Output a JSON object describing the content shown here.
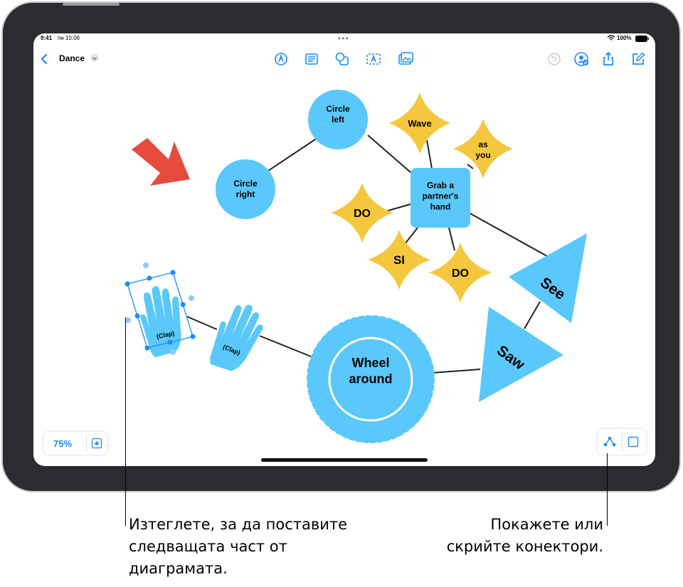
{
  "status_bar": {
    "time": "9:41",
    "date": "пн 10.06",
    "battery": "100%"
  },
  "toolbar": {
    "back_icon": "chevron-left-icon",
    "title": "Dance",
    "title_menu_icon": "chevron-down-icon",
    "center_tools": [
      "pen-icon",
      "text-box-icon",
      "shapes-icon",
      "text-icon",
      "media-icon"
    ],
    "right_tools": [
      "undo-icon",
      "collaborate-icon",
      "share-icon",
      "new-board-icon"
    ],
    "accent": "#1a8cff"
  },
  "board": {
    "nodes": {
      "circle_left": "Circle left",
      "circle_right": "Circle right",
      "wave": "Wave",
      "as_you": "as you",
      "grab": "Grab a partner's hand",
      "do1": "DO",
      "si": "SI",
      "do2": "DO",
      "see": "See",
      "saw": "Saw",
      "wheel": "Wheel around",
      "clap1": "(Clap)",
      "clap2": "(Clap)"
    },
    "colors": {
      "blue": "#5ac8fa",
      "yellow": "#f4c73d",
      "red": "#e64b3c",
      "line": "#222222"
    }
  },
  "zoom": {
    "level": "75%",
    "favorite_icon": "star-icon"
  },
  "connectors": {
    "toggle_icon": "connectors-icon",
    "shape_icon": "square-icon"
  },
  "callouts": {
    "left": "Изтеглете, за да поставите следващата част от диаграмата.",
    "right": "Покажете или скрийте конектори."
  }
}
